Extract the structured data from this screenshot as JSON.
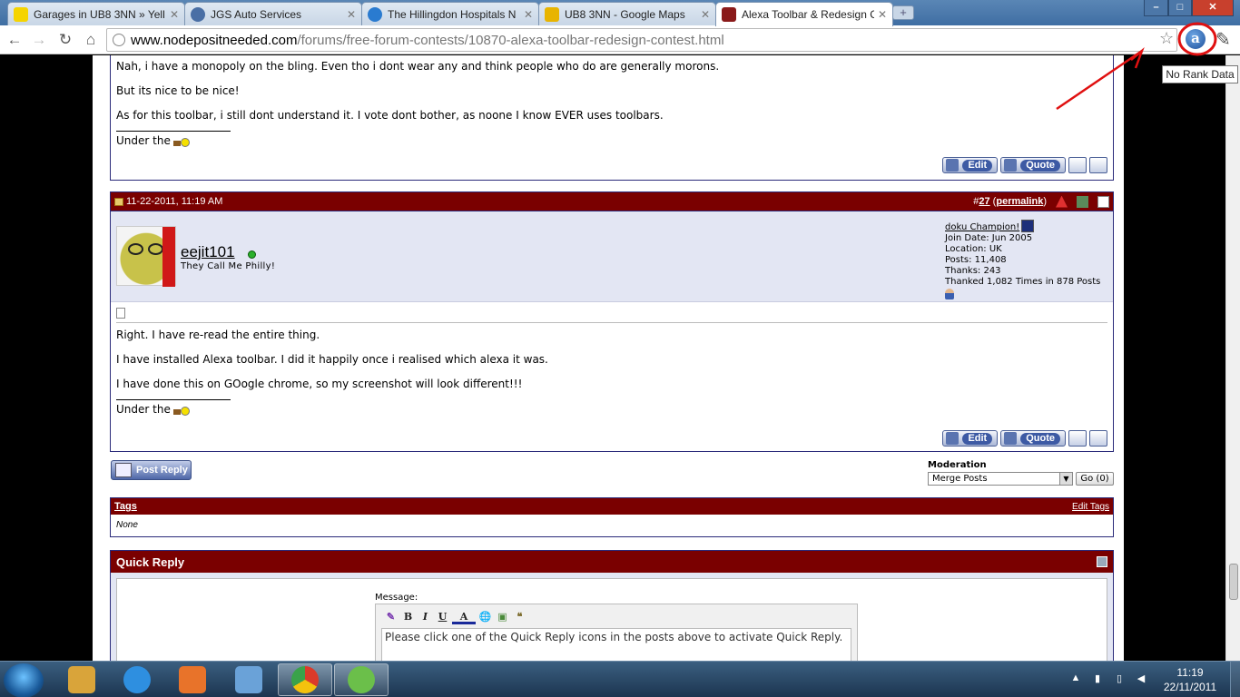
{
  "browser": {
    "tabs": [
      {
        "title": "Garages in UB8 3NN  » Yell",
        "active": false,
        "favicon_color": "#f5d400"
      },
      {
        "title": "JGS Auto Services",
        "active": false,
        "favicon_color": "#4a6fa5"
      },
      {
        "title": "The Hillingdon Hospitals N",
        "active": false,
        "favicon_color": "#2a7bd0"
      },
      {
        "title": "UB8 3NN - Google Maps",
        "active": false,
        "favicon_color": "#e8b400"
      },
      {
        "title": "Alexa Toolbar & Redesign C",
        "active": true,
        "favicon_color": "#8a1a1a"
      }
    ],
    "new_tab_label": "+",
    "url_domain": "www.nodepositneeded.com",
    "url_path": "/forums/free-forum-contests/10870-alexa-toolbar-redesign-contest.html",
    "alexa_icon_letter": "a",
    "tooltip": "No Rank Data",
    "window_controls": {
      "minimize": "–",
      "maximize": "□",
      "close": "✕"
    }
  },
  "posts": [
    {
      "id": "post-26-partial",
      "lines": [
        "Nah, i have a monopoly on the bling. Even tho i dont wear any and think people who do are generally morons.",
        "But its nice to be nice!",
        "As for this toolbar, i still dont understand it. I vote dont bother, as noone I know EVER uses toolbars."
      ],
      "signature": "Under the",
      "edit_label": "Edit",
      "quote_label": "Quote"
    },
    {
      "id": "post-27",
      "date": "11-22-2011, 11:19 AM",
      "number_prefix": "#",
      "number": "27",
      "permalink": "permalink",
      "username": "eejit101",
      "user_title": "They Call Me Philly!",
      "rank": "doku Champion!",
      "join_date": "Join Date: Jun 2005",
      "location": "Location: UK",
      "posts": "Posts: 11,408",
      "thanks": "Thanks: 243",
      "thanked": "Thanked 1,082 Times in 878 Posts",
      "lines": [
        "Right. I have re-read the entire thing.",
        "I have installed Alexa toolbar. I did it happily once i realised which alexa it was.",
        "I have done this on GOogle chrome, so my screenshot will look different!!!"
      ],
      "signature": "Under the",
      "edit_label": "Edit",
      "quote_label": "Quote"
    }
  ],
  "post_reply_label": "Post Reply",
  "moderation": {
    "label": "Moderation",
    "selected": "Merge Posts",
    "go_label": "Go (0)"
  },
  "tags": {
    "title": "Tags",
    "edit_label": "Edit Tags",
    "value": "None"
  },
  "quick_reply": {
    "title": "Quick Reply",
    "message_label": "Message:",
    "placeholder_text": "Please click one of the Quick Reply icons in the posts above to activate Quick Reply.",
    "tools": [
      "B",
      "I",
      "U",
      "A"
    ]
  },
  "taskbar": {
    "time": "11:19",
    "date": "22/11/2011",
    "apps": [
      {
        "name": "explorer",
        "color": "#d9a43a",
        "active": false
      },
      {
        "name": "internet-explorer",
        "color": "#2e8fe0",
        "active": false
      },
      {
        "name": "media-player",
        "color": "#e8732a",
        "active": false
      },
      {
        "name": "paint",
        "color": "#6aa2d8",
        "active": false
      },
      {
        "name": "chrome",
        "color": "#3aa24a",
        "active": true
      },
      {
        "name": "messenger",
        "color": "#6bbf4a",
        "active": false
      }
    ]
  }
}
